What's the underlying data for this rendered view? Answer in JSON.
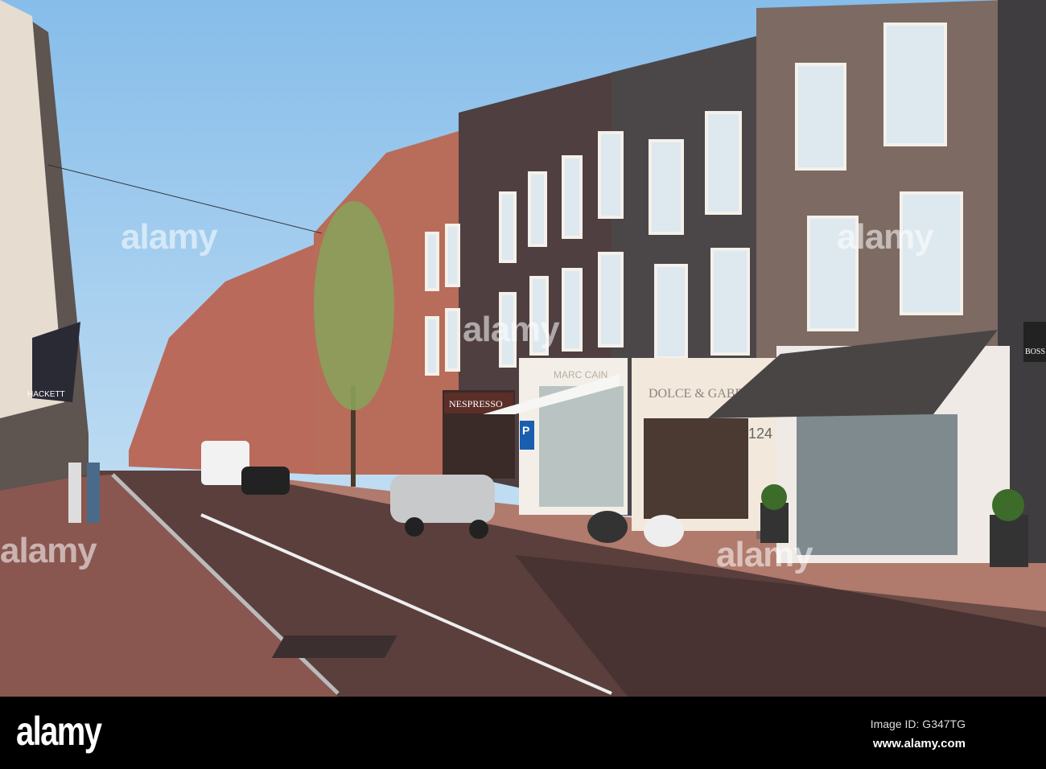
{
  "photo": {
    "scene": "shopping street with brick townhouses",
    "signs": {
      "nespresso": "NESPRESSO",
      "marc_cain": "MARC CAIN",
      "dolce_gabbana": "DOLCE & GABBANA",
      "house_number": "124",
      "hackett": "HACKETT",
      "boss": "BOSS",
      "parking": "P"
    },
    "colors": {
      "sky": "#a9d0ee",
      "road": "#5a3c3a",
      "sidewalk": "#a86a5e",
      "brick_gray": "#4a4445",
      "brick_brown": "#7d6a62"
    }
  },
  "watermark": {
    "text": "alamy",
    "image_id": "Image ID: G347TG",
    "url": "www.alamy.com"
  }
}
